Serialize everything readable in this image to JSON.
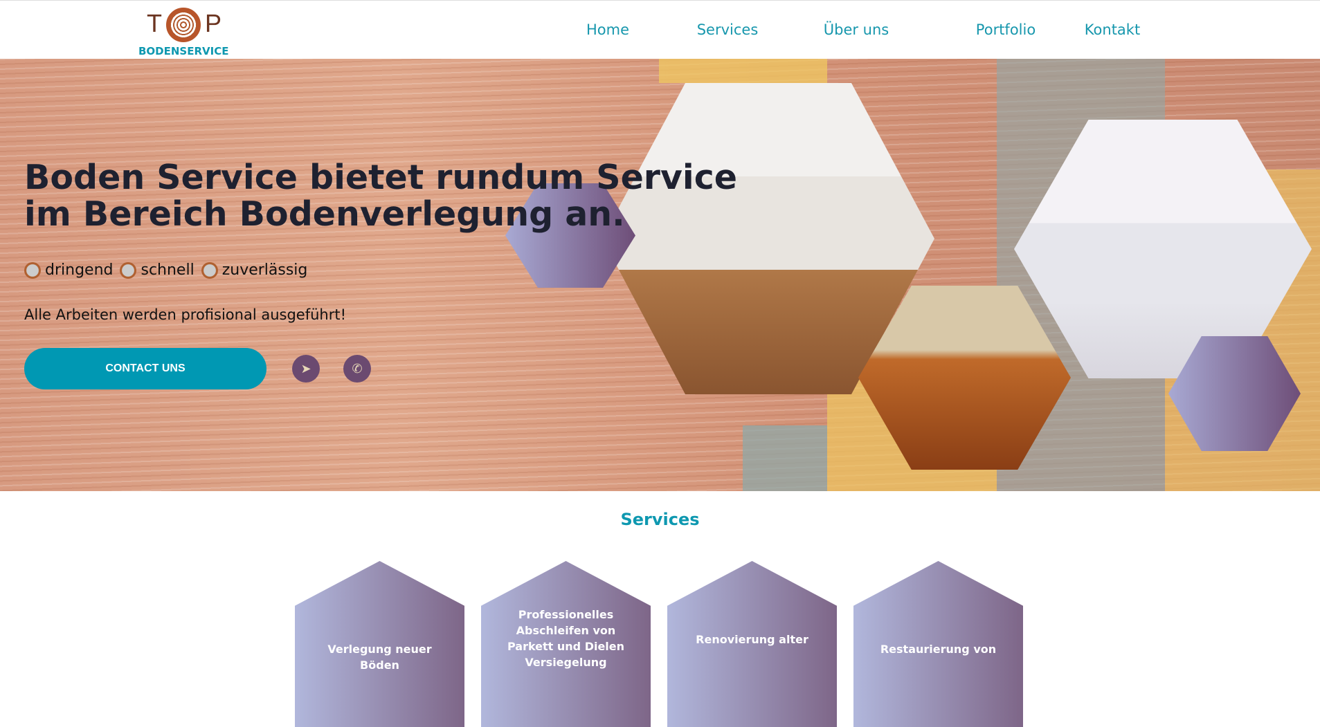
{
  "logo": {
    "letters_left": "T",
    "letters_right": "P",
    "subtitle": "BODENSERVICE"
  },
  "nav": [
    "Home",
    "Services",
    "Über uns",
    "Portfolio",
    "Kontakt"
  ],
  "hero": {
    "headline": "Boden Service bietet rundum Service im Bereich Bodenverlegung an.",
    "features": [
      "dringend",
      "schnell",
      "zuverlässig"
    ],
    "tagline": "Alle Arbeiten werden profisional ausgeführt!",
    "cta": "CONTACT UNS"
  },
  "services": {
    "title": "Services",
    "cards": [
      "Verlegung neuer Böden",
      "Professionelles Abschleifen von Parkett und Dielen Versiegelung",
      "Renovierung alter",
      "Restaurierung von"
    ]
  },
  "colors": {
    "accent": "#0098b3",
    "purple": "#6b4a70"
  }
}
